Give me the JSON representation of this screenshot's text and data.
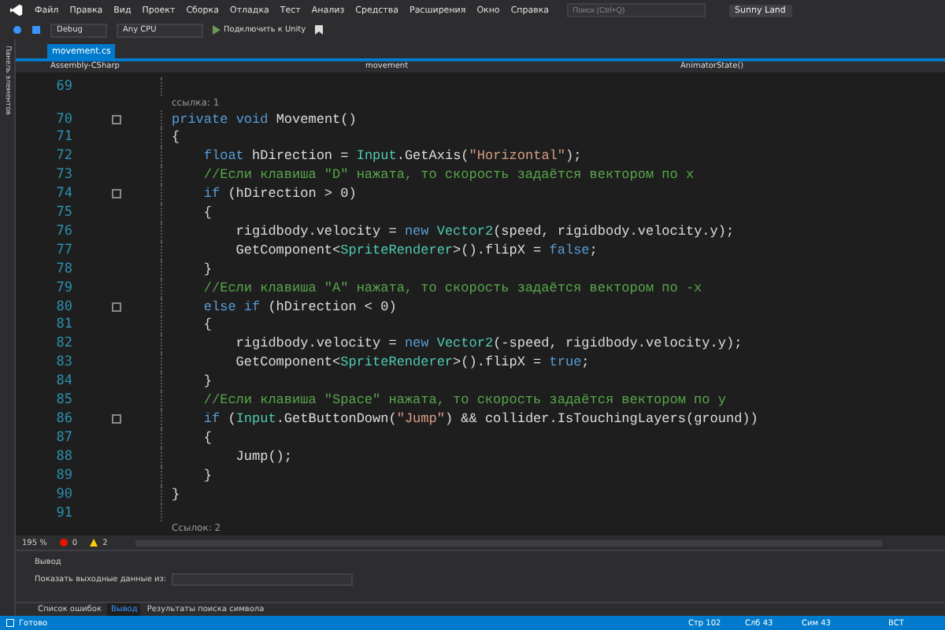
{
  "menu": {
    "items": [
      "Файл",
      "Правка",
      "Вид",
      "Проект",
      "Сборка",
      "Отладка",
      "Тест",
      "Анализ",
      "Средства",
      "Расширения",
      "Окно",
      "Справка"
    ],
    "search": {
      "placeholder": "Поиск (Ctrl+Q)"
    },
    "solution": "Sunny Land"
  },
  "toolbar": {
    "configuration": "Debug",
    "platform": "Any CPU",
    "attach": "Подключить к Unity"
  },
  "side_strip": "Панель элементов",
  "tabs": [
    {
      "label": "movement.cs",
      "selected": true
    }
  ],
  "nav": [
    "Assembly-CSharp",
    "movement",
    "AnimatorState()"
  ],
  "code": [
    {
      "number": "69"
    },
    {
      "lens": "ссылка: 1"
    },
    {
      "number": "70",
      "fold": true,
      "tokens": [
        {
          "kind": "kw",
          "text": "private"
        },
        {
          "kind": "kw",
          "text": " void"
        },
        {
          "kind": "txt",
          "text": " Movement()"
        }
      ]
    },
    {
      "number": "71",
      "tokens": [
        {
          "kind": "txt",
          "text": "{"
        }
      ]
    },
    {
      "number": "72",
      "tokens": [
        {
          "kind": "kw",
          "text": "    float"
        },
        {
          "kind": "txt",
          "text": " hDirection = "
        },
        {
          "kind": "type",
          "text": "Input"
        },
        {
          "kind": "txt",
          "text": ".GetAxis("
        },
        {
          "kind": "str",
          "text": "\"Horizontal\""
        },
        {
          "kind": "txt",
          "text": ");"
        }
      ]
    },
    {
      "number": "73",
      "tokens": [
        {
          "kind": "cmt",
          "text": "    //Если клавиша \"D\" нажата, то скорость задаётся вектором по x"
        }
      ]
    },
    {
      "number": "74",
      "fold": true,
      "tokens": [
        {
          "kind": "kw",
          "text": "    if"
        },
        {
          "kind": "txt",
          "text": " (hDirection > 0)"
        }
      ]
    },
    {
      "number": "75",
      "tokens": [
        {
          "kind": "txt",
          "text": "    {"
        }
      ]
    },
    {
      "number": "76",
      "tokens": [
        {
          "kind": "txt",
          "text": "        rigidbody.velocity = "
        },
        {
          "kind": "kw",
          "text": "new"
        },
        {
          "kind": "type",
          "text": " Vector2"
        },
        {
          "kind": "txt",
          "text": "(speed, rigidbody.velocity.y);"
        }
      ]
    },
    {
      "number": "77",
      "tokens": [
        {
          "kind": "txt",
          "text": "        GetComponent<"
        },
        {
          "kind": "type",
          "text": "SpriteRenderer"
        },
        {
          "kind": "txt",
          "text": ">().flipX = "
        },
        {
          "kind": "kw",
          "text": "false"
        },
        {
          "kind": "txt",
          "text": ";"
        }
      ]
    },
    {
      "number": "78",
      "tokens": [
        {
          "kind": "txt",
          "text": "    }"
        }
      ]
    },
    {
      "number": "79",
      "tokens": [
        {
          "kind": "cmt",
          "text": "    //Если клавиша \"A\" нажата, то скорость задаётся вектором по -x"
        }
      ]
    },
    {
      "number": "80",
      "fold": true,
      "tokens": [
        {
          "kind": "kw",
          "text": "    else if"
        },
        {
          "kind": "txt",
          "text": " (hDirection < 0)"
        }
      ]
    },
    {
      "number": "81",
      "tokens": [
        {
          "kind": "txt",
          "text": "    {"
        }
      ]
    },
    {
      "number": "82",
      "tokens": [
        {
          "kind": "txt",
          "text": "        rigidbody.velocity = "
        },
        {
          "kind": "kw",
          "text": "new"
        },
        {
          "kind": "type",
          "text": " Vector2"
        },
        {
          "kind": "txt",
          "text": "(-speed, rigidbody.velocity.y);"
        }
      ]
    },
    {
      "number": "83",
      "tokens": [
        {
          "kind": "txt",
          "text": "        GetComponent<"
        },
        {
          "kind": "type",
          "text": "SpriteRenderer"
        },
        {
          "kind": "txt",
          "text": ">().flipX = "
        },
        {
          "kind": "kw",
          "text": "true"
        },
        {
          "kind": "txt",
          "text": ";"
        }
      ]
    },
    {
      "number": "84",
      "tokens": [
        {
          "kind": "txt",
          "text": "    }"
        }
      ]
    },
    {
      "number": "85",
      "tokens": [
        {
          "kind": "cmt",
          "text": "    //Если клавиша \"Space\" нажата, то скорость задаётся вектором по y"
        }
      ]
    },
    {
      "number": "86",
      "fold": true,
      "tokens": [
        {
          "kind": "kw",
          "text": "    if"
        },
        {
          "kind": "txt",
          "text": " ("
        },
        {
          "kind": "type",
          "text": "Input"
        },
        {
          "kind": "txt",
          "text": ".GetButtonDown("
        },
        {
          "kind": "str",
          "text": "\"Jump\""
        },
        {
          "kind": "txt",
          "text": ") && collider.IsTouchingLayers(ground))"
        }
      ]
    },
    {
      "number": "87",
      "tokens": [
        {
          "kind": "txt",
          "text": "    {"
        }
      ]
    },
    {
      "number": "88",
      "tokens": [
        {
          "kind": "txt",
          "text": "        Jump();"
        }
      ]
    },
    {
      "number": "89",
      "tokens": [
        {
          "kind": "txt",
          "text": "    }"
        }
      ]
    },
    {
      "number": "90",
      "tokens": [
        {
          "kind": "txt",
          "text": "}"
        }
      ]
    },
    {
      "number": "91"
    },
    {
      "lens": "Ссылок: 2"
    }
  ],
  "editor_status": {
    "zoom": "195 %",
    "errors": "0",
    "warnings": "2"
  },
  "output": {
    "title": "Вывод",
    "source_label": "Показать выходные данные из:"
  },
  "bottom_tabs": [
    {
      "label": "Список ошибок",
      "selected": false
    },
    {
      "label": "Вывод",
      "selected": true
    },
    {
      "label": "Результаты поиска символа",
      "selected": false
    }
  ],
  "status_bar": {
    "message": "Готово",
    "line": "Стр 102",
    "column": "Слб 43",
    "char": "Сим 43",
    "mode": "ВСТ"
  }
}
